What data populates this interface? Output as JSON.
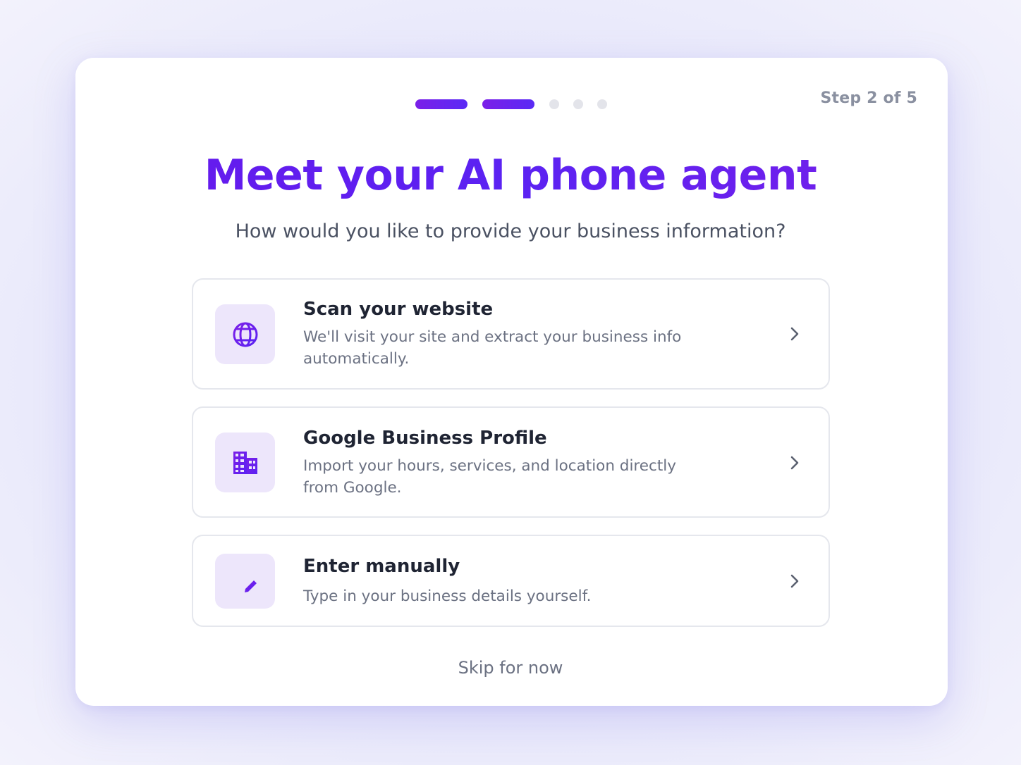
{
  "progress": {
    "total_steps": 5,
    "completed_steps": 2,
    "step_label": "Step 2 of 5"
  },
  "header": {
    "title": "Meet your AI phone agent",
    "subtitle": "How would you like to provide your business information?"
  },
  "options": [
    {
      "icon": "globe-icon",
      "title": "Scan your website",
      "description": "We'll visit your site and extract your business info automatically."
    },
    {
      "icon": "building-icon",
      "title": "Google Business Profile",
      "description": "Import your hours, services, and location directly from Google."
    },
    {
      "icon": "edit-list-icon",
      "title": "Enter manually",
      "description": "Type in your business details yourself."
    }
  ],
  "footer": {
    "skip_label": "Skip for now"
  },
  "colors": {
    "accent": "#6a17ea",
    "accent_secondary": "#5b22f2",
    "icon_bg": "#ede6fb",
    "inactive_dot": "#e3e4ea",
    "heading_text": "#1f2433",
    "muted_text": "#6b7182"
  }
}
